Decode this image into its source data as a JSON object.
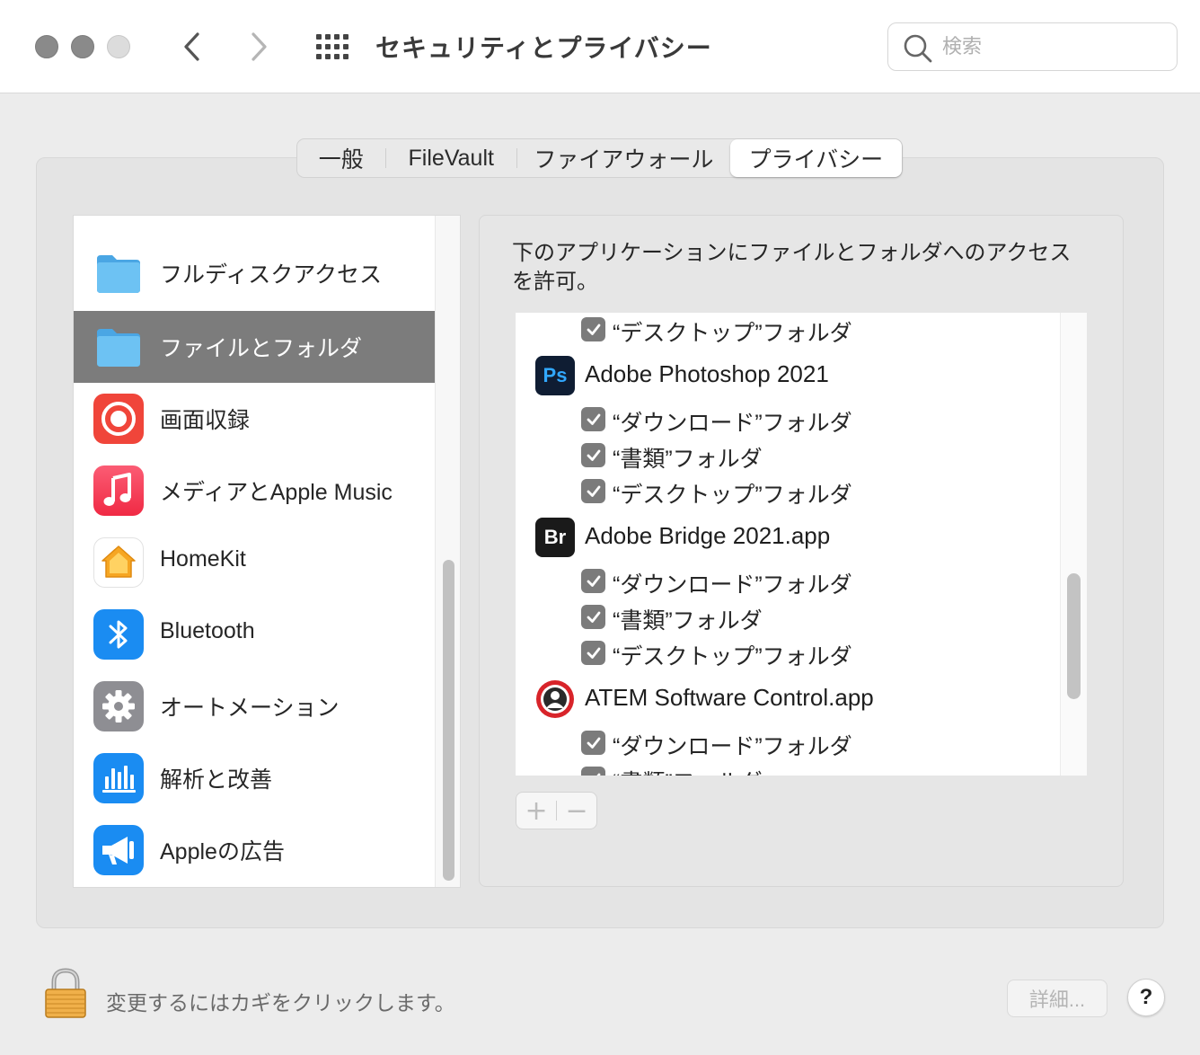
{
  "window": {
    "title": "セキュリティとプライバシー",
    "search_placeholder": "検索"
  },
  "tabs": [
    {
      "label": "一般",
      "selected": false
    },
    {
      "label": "FileVault",
      "selected": false
    },
    {
      "label": "ファイアウォール",
      "selected": false
    },
    {
      "label": "プライバシー",
      "selected": true
    }
  ],
  "sidebar": {
    "items": [
      {
        "label": "フルディスクアクセス",
        "icon": "folder-icon",
        "selected": false
      },
      {
        "label": "ファイルとフォルダ",
        "icon": "folder-icon",
        "selected": true
      },
      {
        "label": "画面収録",
        "icon": "screen-recording-icon",
        "selected": false
      },
      {
        "label": "メディアとApple Music",
        "icon": "music-note-icon",
        "selected": false
      },
      {
        "label": "HomeKit",
        "icon": "home-icon",
        "selected": false
      },
      {
        "label": "Bluetooth",
        "icon": "bluetooth-icon",
        "selected": false
      },
      {
        "label": "オートメーション",
        "icon": "gear-icon",
        "selected": false
      },
      {
        "label": "解析と改善",
        "icon": "analytics-icon",
        "selected": false
      },
      {
        "label": "Appleの広告",
        "icon": "megaphone-icon",
        "selected": false
      }
    ]
  },
  "detail": {
    "description": "下のアプリケーションにファイルとフォルダへのアクセスを許可。",
    "rows": [
      {
        "type": "folder",
        "label": "“デスクトップ”フォルダ",
        "checked": true
      },
      {
        "type": "app",
        "label": "Adobe Photoshop 2021",
        "icon": "photoshop-icon",
        "badge": "Ps"
      },
      {
        "type": "folder",
        "label": "“ダウンロード”フォルダ",
        "checked": true
      },
      {
        "type": "folder",
        "label": "“書類”フォルダ",
        "checked": true
      },
      {
        "type": "folder",
        "label": "“デスクトップ”フォルダ",
        "checked": true
      },
      {
        "type": "app",
        "label": "Adobe Bridge 2021.app",
        "icon": "bridge-icon",
        "badge": "Br"
      },
      {
        "type": "folder",
        "label": "“ダウンロード”フォルダ",
        "checked": true
      },
      {
        "type": "folder",
        "label": "“書類”フォルダ",
        "checked": true
      },
      {
        "type": "folder",
        "label": "“デスクトップ”フォルダ",
        "checked": true
      },
      {
        "type": "app",
        "label": "ATEM Software Control.app",
        "icon": "atem-icon"
      },
      {
        "type": "folder",
        "label": "“ダウンロード”フォルダ",
        "checked": true
      },
      {
        "type": "folder",
        "label": "“書類”フォルダ",
        "checked": true
      }
    ],
    "add_label": "+",
    "remove_label": "−"
  },
  "footer": {
    "lock_text": "変更するにはカギをクリックします。",
    "advanced_label": "詳細...",
    "help_label": "?"
  },
  "colors": {
    "selected_row": "#7c7c7c",
    "folder_blue": "#5bb8ef",
    "checkbox_gray": "#7b7b7b"
  }
}
